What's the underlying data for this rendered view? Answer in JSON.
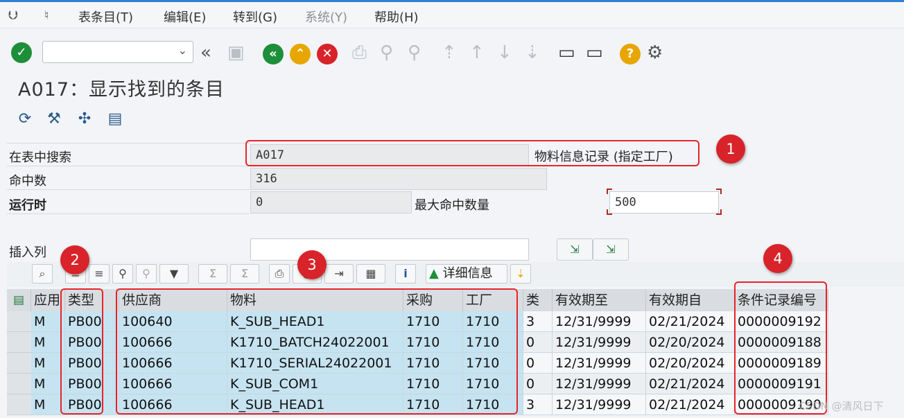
{
  "menu": {
    "items": [
      {
        "label": "表条目(T)"
      },
      {
        "label": "编辑(E)"
      },
      {
        "label": "转到(G)"
      },
      {
        "label": "系统(Y)"
      },
      {
        "label": "帮助(H)"
      }
    ]
  },
  "toolbar": {
    "command_field_value": "",
    "icons": [
      "enter-icon",
      "back-icon",
      "save-icon",
      "back-green-icon",
      "exit-icon",
      "cancel-icon",
      "print-icon",
      "find-icon",
      "find-next-icon",
      "first-page-icon",
      "prev-page-icon",
      "next-page-icon",
      "last-page-icon",
      "create-session-icon",
      "shortcut-icon",
      "help-icon",
      "settings-icon"
    ]
  },
  "title": "A017：显示找到的条目",
  "app_toolbar": {
    "icons": [
      "refresh-icon",
      "tools-icon",
      "puzzle-icon",
      "document-icon"
    ]
  },
  "form": {
    "search_table_label": "在表中搜索",
    "search_table_value": "A017",
    "search_table_desc": "物料信息记录 (指定工厂)",
    "hits_label": "命中数",
    "hits_value": "316",
    "runtime_label": "运行时",
    "runtime_value": "0",
    "max_hits_label": "最大命中数量",
    "max_hits_value": "500",
    "insert_column_label": "插入列",
    "insert_column_value": ""
  },
  "alv_toolbar": {
    "details_label": "详细信息"
  },
  "table": {
    "columns": [
      "应用",
      "类型",
      "供应商",
      "物料",
      "采购",
      "工厂",
      "类",
      "有效期至",
      "有效期自",
      "条件记录编号"
    ],
    "rows": [
      [
        "M",
        "PB00",
        "100640",
        "K_SUB_HEAD1",
        "1710",
        "1710",
        "3",
        "12/31/9999",
        "02/21/2024",
        "0000009192"
      ],
      [
        "M",
        "PB00",
        "100666",
        "K1710_BATCH24022001",
        "1710",
        "1710",
        "0",
        "12/31/9999",
        "02/20/2024",
        "0000009188"
      ],
      [
        "M",
        "PB00",
        "100666",
        "K1710_SERIAL24022001",
        "1710",
        "1710",
        "0",
        "12/31/9999",
        "02/20/2024",
        "0000009189"
      ],
      [
        "M",
        "PB00",
        "100666",
        "K_SUB_COM1",
        "1710",
        "1710",
        "0",
        "12/31/9999",
        "02/21/2024",
        "0000009191"
      ],
      [
        "M",
        "PB00",
        "100666",
        "K_SUB_HEAD1",
        "1710",
        "1710",
        "3",
        "12/31/9999",
        "02/21/2024",
        "0000009190"
      ]
    ]
  },
  "annotations": {
    "badges": [
      "1",
      "2",
      "3",
      "4"
    ],
    "color": "#e8232a"
  },
  "watermark": "CSDN @清风日下"
}
